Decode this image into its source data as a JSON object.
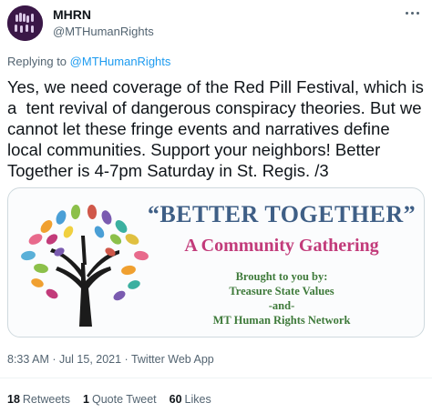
{
  "tweet": {
    "author_name": "MHRN",
    "author_handle": "@MTHumanRights",
    "replying_to_prefix": "Replying to",
    "replying_to_handle": "@MTHumanRights",
    "text": "Yes, we need coverage of the Red Pill Festival, which is\na  tent revival of dangerous conspiracy theories. But we\ncannot let these fringe events and narratives define\nlocal communities. Support your neighbors! Better\nTogether is 4-7pm Saturday in St. Regis. /3",
    "timestamp": "8:33 AM · Jul 15, 2021 · Twitter Web App"
  },
  "image_card": {
    "title": "“BETTER TOGETHER”",
    "subtitle": "A Community Gathering",
    "lines": [
      "Brought to you by:",
      "Treasure State Values",
      "-and-",
      "MT Human Rights Network"
    ]
  },
  "stats": {
    "retweets_count": "18",
    "retweets_label": "Retweets",
    "quotes_count": "1",
    "quotes_label": "Quote Tweet",
    "likes_count": "60",
    "likes_label": "Likes"
  },
  "colors": {
    "link": "#1d9bf0",
    "banner_title": "#3f5f86",
    "banner_subtitle": "#c23b7a",
    "banner_text": "#3e7a3a"
  },
  "icons": {
    "more": "more-icon",
    "avatar": "avatar-hands-icon",
    "tree": "hands-tree-icon"
  }
}
